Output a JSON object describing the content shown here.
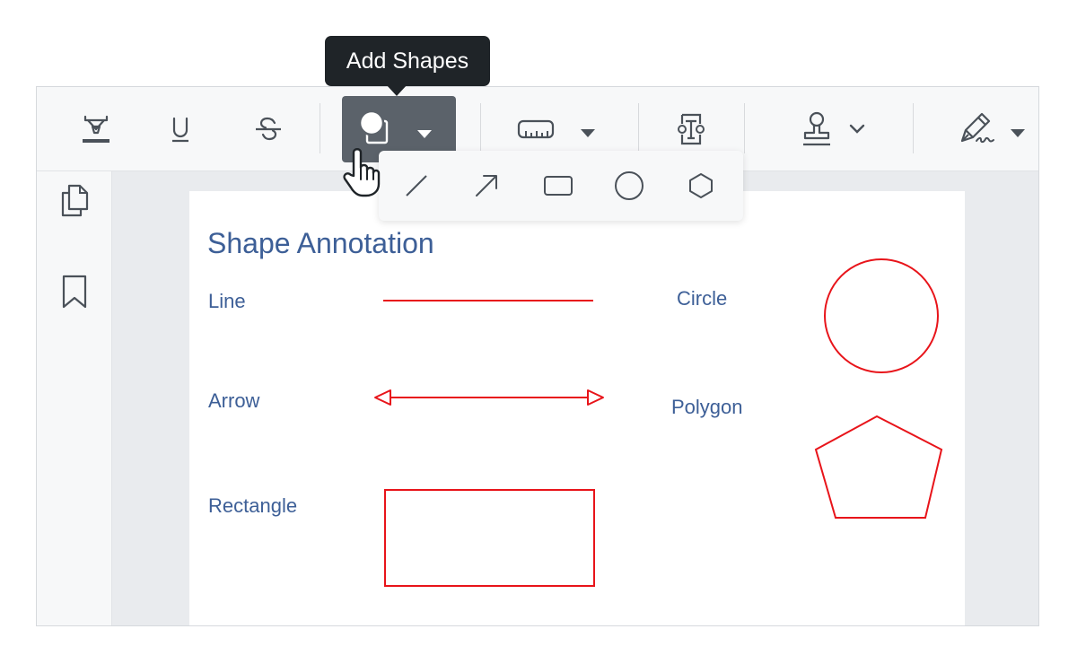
{
  "tooltip": {
    "text": "Add Shapes"
  },
  "toolbar": {
    "items": [
      {
        "icon": "highlight-icon"
      },
      {
        "icon": "underline-icon"
      },
      {
        "icon": "strikethrough-icon"
      },
      {
        "icon": "add-shapes-icon",
        "active": true
      },
      {
        "icon": "measure-ruler-icon"
      },
      {
        "icon": "text-box-icon"
      },
      {
        "icon": "stamp-icon"
      },
      {
        "icon": "signature-pen-icon"
      }
    ]
  },
  "shape_menu": {
    "items": [
      {
        "icon": "line-icon"
      },
      {
        "icon": "arrow-icon"
      },
      {
        "icon": "rectangle-icon"
      },
      {
        "icon": "circle-icon"
      },
      {
        "icon": "polygon-icon"
      }
    ]
  },
  "sidebar": {
    "items": [
      {
        "icon": "pages-icon"
      },
      {
        "icon": "bookmark-icon"
      }
    ]
  },
  "document": {
    "title": "Shape Annotation",
    "labels": {
      "line": "Line",
      "arrow": "Arrow",
      "rectangle": "Rectangle",
      "circle": "Circle",
      "polygon": "Polygon"
    }
  },
  "colors": {
    "annotation": "#e8141a",
    "doc_text": "#3d5f97",
    "icon": "#4a5159",
    "active_button": "#5b626a",
    "tooltip_bg": "#1f2428"
  }
}
